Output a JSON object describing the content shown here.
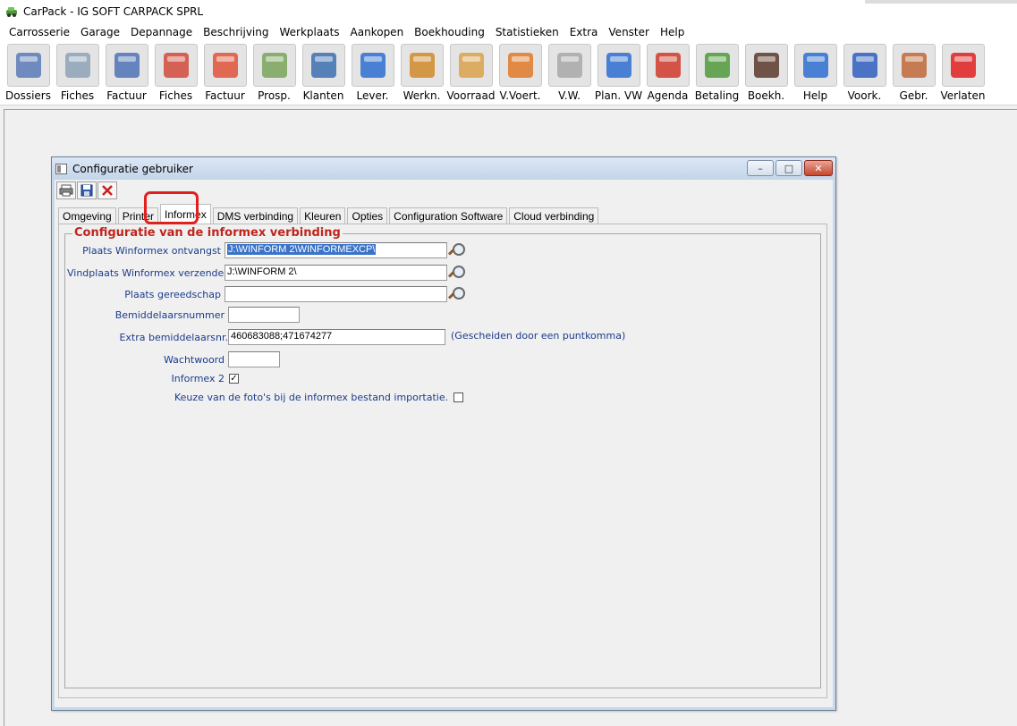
{
  "app": {
    "title": "CarPack - IG SOFT CARPACK SPRL"
  },
  "menu": [
    "Carrosserie",
    "Garage",
    "Depannage",
    "Beschrijving",
    "Werkplaats",
    "Aankopen",
    "Boekhouding",
    "Statistieken",
    "Extra",
    "Venster",
    "Help"
  ],
  "toolbar": [
    {
      "label": "Dossiers",
      "icon": "folder-documents-icon",
      "color": "#5a7ab8"
    },
    {
      "label": "Fiches",
      "icon": "tools-icon",
      "color": "#8fa2b8"
    },
    {
      "label": "Factuur",
      "icon": "invoice-add-icon",
      "color": "#4f72b6"
    },
    {
      "label": "Fiches",
      "icon": "tools-red-icon",
      "color": "#d14a3a"
    },
    {
      "label": "Factuur",
      "icon": "invoice-red-add-icon",
      "color": "#e0543a"
    },
    {
      "label": "Prosp.",
      "icon": "prospect-search-icon",
      "color": "#7aa45a"
    },
    {
      "label": "Klanten",
      "icon": "customer-icon",
      "color": "#3c6fb0"
    },
    {
      "label": "Lever.",
      "icon": "truck-icon",
      "color": "#2f6fd0"
    },
    {
      "label": "Werkn.",
      "icon": "worker-icon",
      "color": "#d08a2a"
    },
    {
      "label": "Voorraad",
      "icon": "boxes-icon",
      "color": "#d9a24a"
    },
    {
      "label": "V.Voert.",
      "icon": "car-orange-icon",
      "color": "#e07a2a"
    },
    {
      "label": "V.W.",
      "icon": "car-silver-icon",
      "color": "#a8a8a8"
    },
    {
      "label": "Plan. VW",
      "icon": "keys-icon",
      "color": "#2f6fd0"
    },
    {
      "label": "Agenda",
      "icon": "calendar-icon",
      "color": "#d03a2a"
    },
    {
      "label": "Betaling",
      "icon": "payment-icon",
      "color": "#4f9a3a"
    },
    {
      "label": "Boekh.",
      "icon": "books-icon",
      "color": "#5a3a2a"
    },
    {
      "label": "Help",
      "icon": "help-icon",
      "color": "#2f6fd0"
    },
    {
      "label": "Voork.",
      "icon": "gear-icon",
      "color": "#2f5fc0"
    },
    {
      "label": "Gebr.",
      "icon": "users-icon",
      "color": "#c06a3a"
    },
    {
      "label": "Verlaten",
      "icon": "power-icon",
      "color": "#e02020"
    }
  ],
  "window": {
    "title": "Configuratie gebruiker",
    "mini_tools": [
      "printer-icon",
      "save-icon",
      "delete-icon"
    ],
    "tabs": [
      "Omgeving",
      "Printer",
      "Informex",
      "DMS verbinding",
      "Kleuren",
      "Opties",
      "Configuration Software",
      "Cloud verbinding"
    ],
    "active_tab": "Informex",
    "group_title": "Configuratie van de informex verbinding",
    "fields": {
      "plaats_ontvangst_label": "Plaats Winformex ontvangst",
      "plaats_ontvangst_value": "J:\\WINFORM 2\\WINFORMEXCP\\",
      "vindplaats_label": "Vindplaats Winformex verzenden",
      "vindplaats_value": "J:\\WINFORM 2\\",
      "gereedschap_label": "Plaats gereedschap",
      "gereedschap_value": "",
      "bemiddelaar_label": "Bemiddelaarsnummer",
      "bemiddelaar_value": "",
      "extra_label": "Extra bemiddelaarsnr.",
      "extra_value": "460683088;471674277",
      "extra_hint": "(Gescheiden door een puntkomma)",
      "wachtwoord_label": "Wachtwoord",
      "wachtwoord_value": "",
      "informex2_label": "Informex 2",
      "informex2_checked": true,
      "keuze_label": "Keuze van de foto's bij de informex bestand importatie.",
      "keuze_checked": false
    }
  }
}
